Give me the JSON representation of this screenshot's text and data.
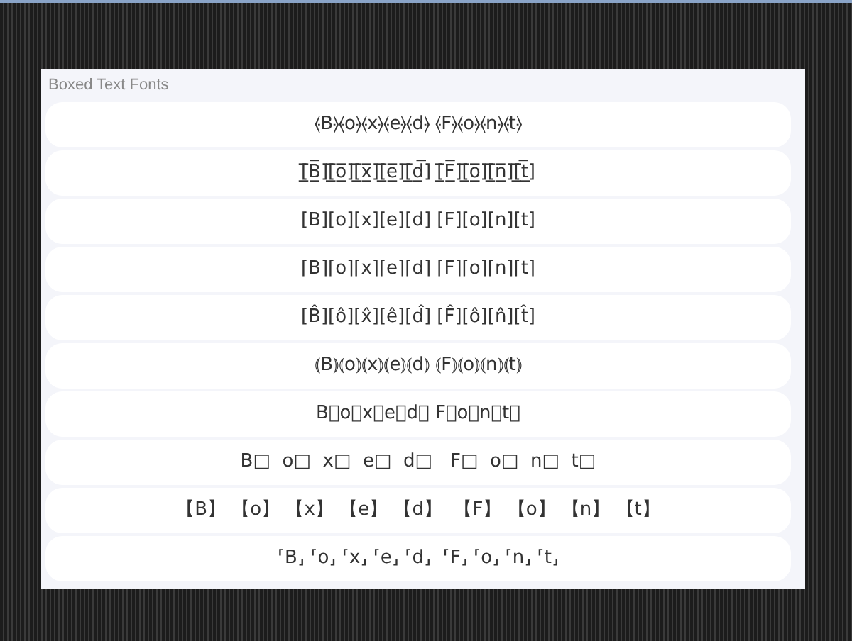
{
  "panel": {
    "title": "Boxed Text Fonts"
  },
  "rows": [
    {
      "text": "⦑B⦒⦑o⦒⦑x⦒⦑e⦒⦑d⦒ ⦑F⦒⦑o⦒⦑n⦒⦑t⦒"
    },
    {
      "text": "[̲̅B̲̅][̲̅o̲̅][̲̅x̲̅][̲̅e̲̅][̲̅d̲̅] [̲̅F̲̅][̲̅o̲̅][̲̅n̲̅][̲̅t̲̅]"
    },
    {
      "text": "[B][o][x][e][d] [F][o][n][t]"
    },
    {
      "text": "⌈B⌉⌈o⌉⌈x⌉⌈e⌉⌈d⌉ ⌈F⌉⌈o⌉⌈n⌉⌈t⌉"
    },
    {
      "text": "[B̂][ô][x̂][ê][d̂] [F̂][ô][n̂][t̂]"
    },
    {
      "text": "⦅B⦆⦅o⦆⦅x⦆⦅e⦆⦅d⦆ ⦅F⦆⦅o⦆⦅n⦆⦅t⦆"
    },
    {
      "text": "B⃞o⃞x⃞e⃞d⃞ F⃞o⃞n⃞t⃞"
    },
    {
      "text": "B□  o□  x□  e□  d□   F□  o□  n□  t□"
    },
    {
      "text": "【B】 【o】 【x】 【e】 【d】  【F】 【o】 【n】 【t】"
    },
    {
      "text": "⸢B⸥ ⸢o⸥ ⸢x⸥ ⸢e⸥ ⸢d⸥  ⸢F⸥ ⸢o⸥ ⸢n⸥ ⸢t⸥"
    }
  ]
}
